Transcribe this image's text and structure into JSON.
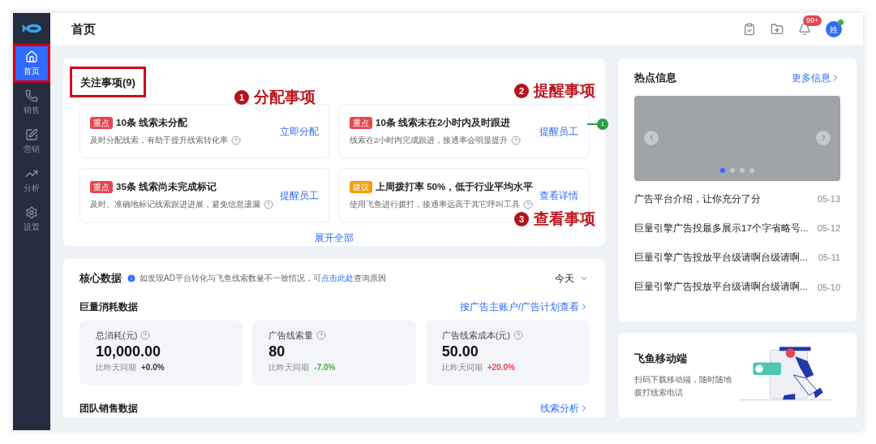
{
  "sidebar": {
    "items": [
      {
        "label": "首页",
        "kind": "home",
        "selected": true,
        "highlighted": true
      },
      {
        "label": "销售",
        "kind": "phone",
        "selected": false,
        "highlighted": false
      },
      {
        "label": "营销",
        "kind": "edit",
        "selected": false,
        "highlighted": false
      },
      {
        "label": "分析",
        "kind": "chart",
        "selected": false,
        "highlighted": false
      },
      {
        "label": "设置",
        "kind": "gear",
        "selected": false,
        "highlighted": false
      }
    ]
  },
  "header": {
    "title": "首页",
    "notification_badge": "99+",
    "avatar": "姓",
    "online": true
  },
  "focus": {
    "title": "关注事项(9)",
    "highlighted": true,
    "items": [
      {
        "tag": "重点",
        "kind": "key",
        "title": "10条 线索未分配",
        "desc": "及时分配线索，有助于提升线索转化率",
        "action": "立即分配"
      },
      {
        "tag": "重点",
        "kind": "key",
        "title": "10条 线索未在2小时内及时跟进",
        "desc": "线索在2小时内完成跟进，接通率会明显提升",
        "action": "提醒员工"
      },
      {
        "tag": "重点",
        "kind": "key",
        "title": "35条 线索尚未完成标记",
        "desc": "及时、准确地标记线索跟进进展，避免信息遗漏",
        "action": "提醒员工"
      },
      {
        "tag": "建议",
        "kind": "suggest",
        "title": "上周拨打率 50%，低于行业平均水平",
        "desc": "使用飞鱼进行拨打，接通率远高于其它呼叫工具",
        "action": "查看详情"
      }
    ],
    "expand": "展开全部"
  },
  "annotations": {
    "callouts": [
      {
        "number": "1",
        "label": "分配事项"
      },
      {
        "number": "2",
        "label": "提醒事项"
      },
      {
        "number": "3",
        "label": "查看事项"
      }
    ],
    "marker": {
      "number": "1"
    }
  },
  "core": {
    "title": "核心数据",
    "notice_before": "如发现AD平台转化与飞鱼线索数量不一致情况，可",
    "notice_link": "点击此处",
    "notice_after": "查询原因",
    "period": "今天",
    "spend": {
      "title": "巨量消耗数据",
      "link": "按广告主账户/广告计划查看",
      "metrics": [
        {
          "label": "总消耗(元)",
          "value": "10,000.00",
          "compare": "比昨天同期",
          "change": "+0.0%",
          "kind": "flat"
        },
        {
          "label": "广告线索量",
          "value": "80",
          "compare": "比昨天同期",
          "change": "-7.0%",
          "kind": "down"
        },
        {
          "label": "广告线索成本(元)",
          "value": "50.00",
          "compare": "比昨天同期",
          "change": "+20.0%",
          "kind": "up"
        }
      ]
    },
    "team": {
      "title": "团队销售数据",
      "link": "线索分析"
    }
  },
  "hot": {
    "title": "热点信息",
    "more": "更多信息",
    "dots": [
      {
        "selected": true
      },
      {
        "selected": false
      },
      {
        "selected": false
      },
      {
        "selected": false
      }
    ],
    "news": [
      {
        "title": "广告平台介绍，让你充分了分",
        "date": "05-13"
      },
      {
        "title": "巨量引擎广告投最多展示17个字省略号...",
        "date": "05-12"
      },
      {
        "title": "巨量引擎广告投放平台级请啊台级请啊...",
        "date": "05-11"
      },
      {
        "title": "巨量引擎广告投放平台级请啊台级请啊...",
        "date": "05-10"
      }
    ]
  },
  "mobile": {
    "title": "飞鱼移动端",
    "desc": "扫码下载移动端，随时随地拨打线索电话"
  }
}
